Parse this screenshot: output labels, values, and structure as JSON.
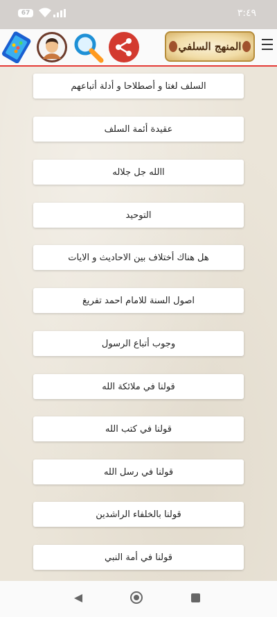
{
  "status_bar": {
    "time": "٣:٤٩",
    "battery": "67"
  },
  "toolbar": {
    "logo_text": "المنهج السلفي",
    "icons": [
      "phone-apps-icon",
      "avatar-icon",
      "search-icon",
      "share-icon",
      "menu-icon"
    ],
    "colors": {
      "accent_line": "#e53935",
      "share_bg": "#d33a2f",
      "search_lens": "#1e90d6"
    }
  },
  "menu": {
    "items": [
      "السلف لغتا و أصطلاحا و أدلة أتباعهم",
      "عقيدة أئمة السلف",
      "االله جل جلاله",
      "التوحيد",
      "هل هناك أختلاف بين الاحاديث و الايات",
      "اصول السنة للامام احمد تفريغ",
      "وجوب أتباع الرسول",
      "قولنا في ملائكة الله",
      "قولنا في كتب الله",
      "قولنا في رسل الله",
      "قولنا بالخلفاء الراشدين",
      "قولنا في أمة النبي"
    ]
  }
}
